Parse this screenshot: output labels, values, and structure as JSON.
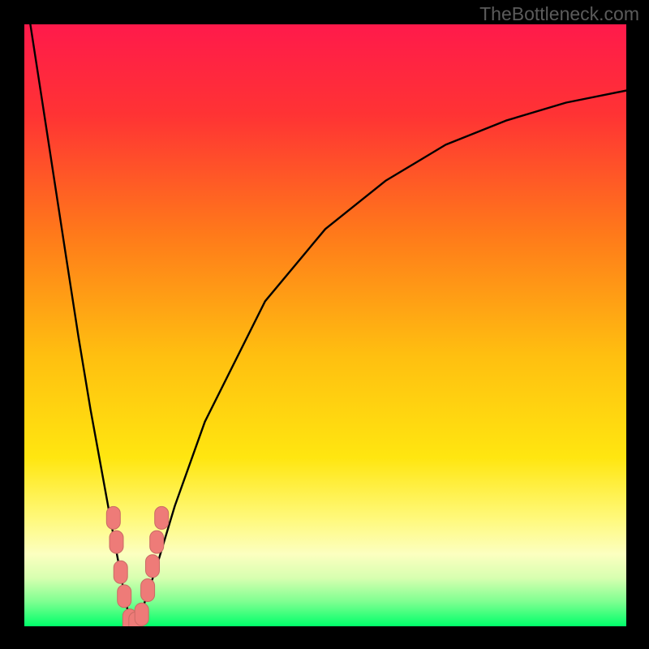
{
  "watermark": "TheBottleneck.com",
  "colors": {
    "frame": "#000000",
    "curve_stroke": "#000000",
    "marker_fill": "#ee7b78",
    "marker_stroke": "#c96a64",
    "green_band": "#00ff6a",
    "gradient_stops": [
      {
        "offset": 0.0,
        "color": "#ff1a4b"
      },
      {
        "offset": 0.15,
        "color": "#ff3334"
      },
      {
        "offset": 0.35,
        "color": "#ff7a1a"
      },
      {
        "offset": 0.55,
        "color": "#ffbf10"
      },
      {
        "offset": 0.72,
        "color": "#ffe610"
      },
      {
        "offset": 0.82,
        "color": "#fff97a"
      },
      {
        "offset": 0.88,
        "color": "#fcffc0"
      },
      {
        "offset": 0.92,
        "color": "#d7ffb0"
      },
      {
        "offset": 0.96,
        "color": "#7cff90"
      },
      {
        "offset": 1.0,
        "color": "#00ff6a"
      }
    ]
  },
  "chart_data": {
    "type": "line",
    "title": "",
    "xlabel": "",
    "ylabel": "",
    "xlim": [
      0,
      100
    ],
    "ylim": [
      0,
      100
    ],
    "note": "V-shaped bottleneck curve. Values are estimated from pixel positions (x = horizontal 0–100, y = bottleneck % 0 = bottom green, 100 = top red).",
    "series": [
      {
        "name": "bottleneck_curve",
        "x": [
          1,
          3,
          5,
          7,
          9,
          11,
          13,
          15,
          16.5,
          17.5,
          18.5,
          20,
          22,
          25,
          30,
          40,
          50,
          60,
          70,
          80,
          90,
          100
        ],
        "y": [
          100,
          87,
          74,
          61,
          48,
          36,
          25,
          14,
          6,
          1,
          0,
          4,
          10,
          20,
          34,
          54,
          66,
          74,
          80,
          84,
          87,
          89
        ]
      }
    ],
    "markers": {
      "name": "highlighted_points",
      "note": "Pink lozenge markers clustered near the valley bottom.",
      "points": [
        {
          "x": 14.8,
          "y": 18
        },
        {
          "x": 15.3,
          "y": 14
        },
        {
          "x": 16.0,
          "y": 9
        },
        {
          "x": 16.6,
          "y": 5
        },
        {
          "x": 17.5,
          "y": 1
        },
        {
          "x": 18.5,
          "y": 0.5
        },
        {
          "x": 19.5,
          "y": 2
        },
        {
          "x": 20.5,
          "y": 6
        },
        {
          "x": 21.3,
          "y": 10
        },
        {
          "x": 22.0,
          "y": 14
        },
        {
          "x": 22.8,
          "y": 18
        }
      ]
    }
  }
}
